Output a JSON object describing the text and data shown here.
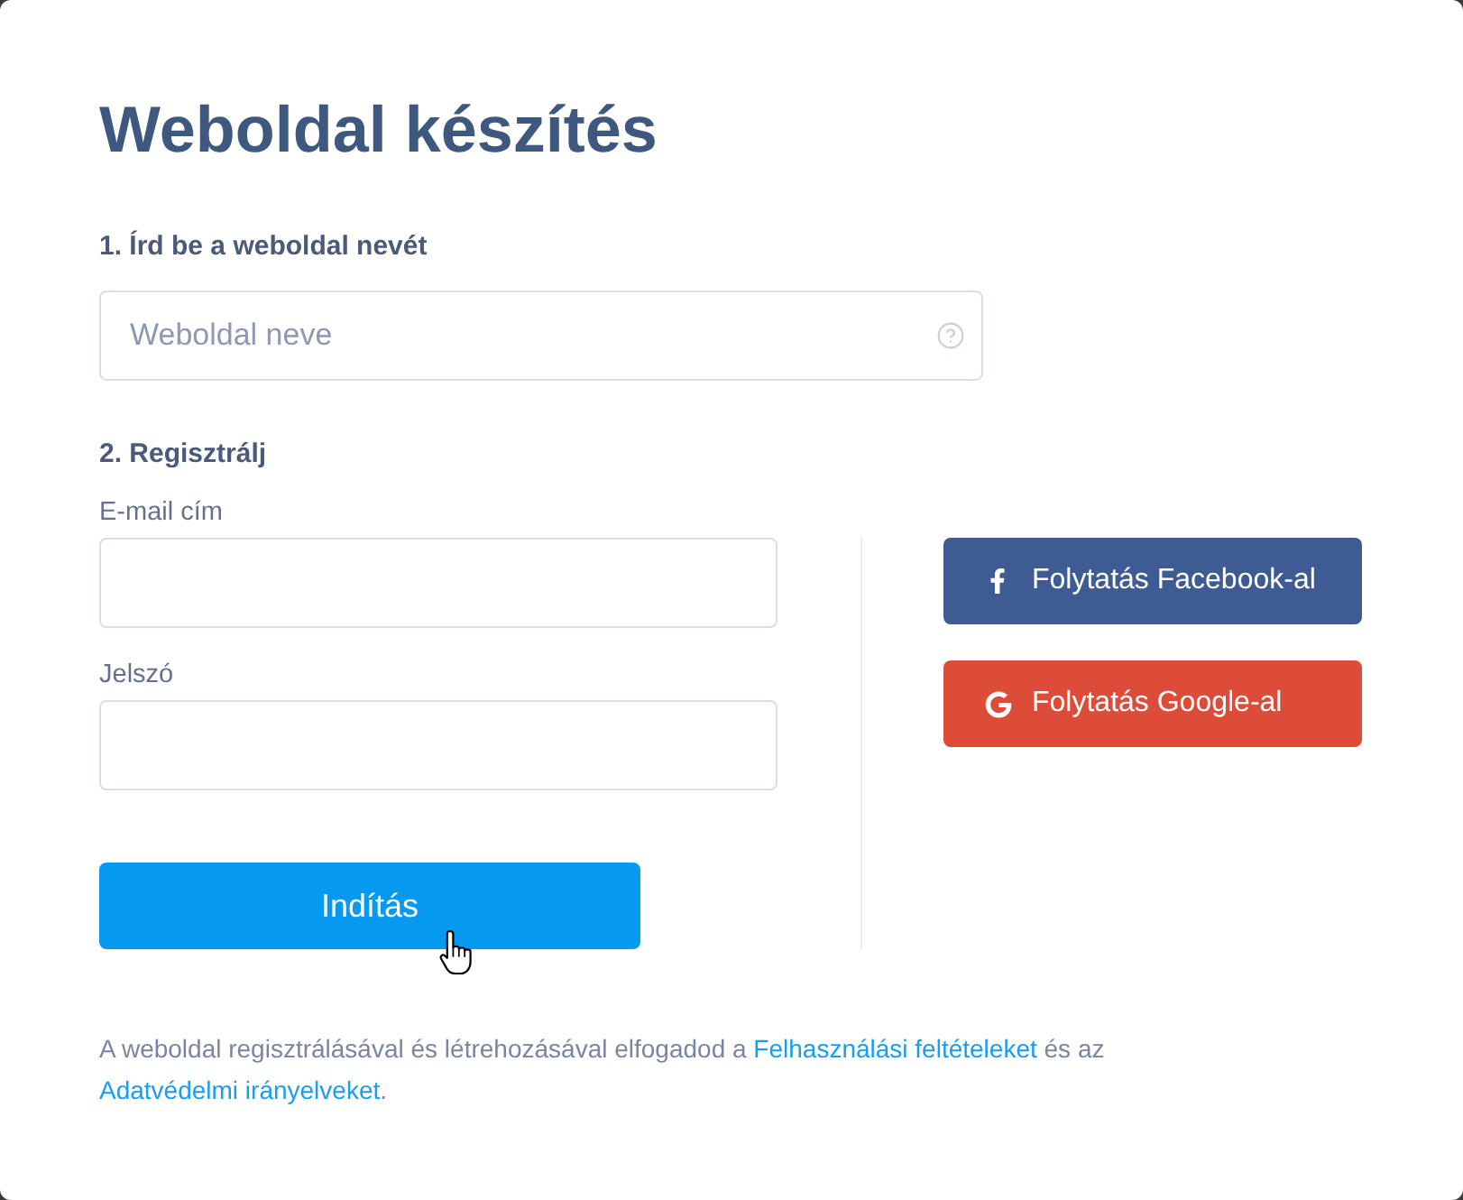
{
  "title": "Weboldal készítés",
  "site_name": {
    "label": "1. Írd be a weboldal nevét",
    "placeholder": "Weboldal neve"
  },
  "registration": {
    "label": "2. Regisztrálj",
    "fields": [
      {
        "label": "E-mail cím"
      },
      {
        "label": "Jelszó"
      }
    ],
    "submit": "Indítás",
    "social_buttons": [
      {
        "kind": "facebook",
        "label": "Folytatás Facebook-al"
      },
      {
        "kind": "google",
        "label": "Folytatás Google-al"
      }
    ]
  },
  "terms": [
    {
      "kind": "text",
      "text": "A weboldal regisztrálásával és létrehozásával elfogadod a "
    },
    {
      "kind": "link",
      "text": "Felhasználási feltételeket"
    },
    {
      "kind": "text",
      "text": " és az "
    },
    {
      "kind": "link",
      "text": "Adatvédelmi irányelveket"
    },
    {
      "kind": "text",
      "text": "."
    }
  ]
}
